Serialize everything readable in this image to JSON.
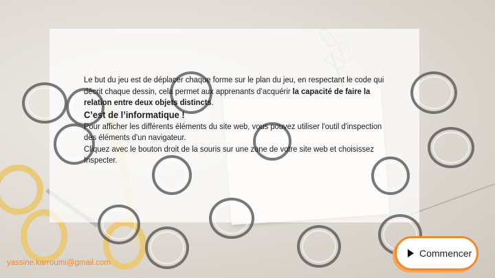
{
  "intro": {
    "text_before": "Le but du jeu est de déplacer chaque forme sur le plan du jeu, en respectant le code qui décrit chaque dessin, cela permet aux apprenants d’acquérir ",
    "text_bold": "la capacité de faire la relation entre deux objets distincts",
    "text_after": "."
  },
  "section": {
    "heading": "C’est de l’informatique !",
    "line1": "Pour afficher les différents éléments du site web, vous pouvez utiliser l'outil d'inspection des éléments d'un navigateur.",
    "line2": "Cliquez avec le bouton droit de la souris sur une zone de votre site web et choisissez Inspecter."
  },
  "start_button": {
    "label": "Commencer"
  },
  "footer": {
    "email": "yassine.karroumi@gmail.com"
  },
  "colors": {
    "accent": "#f08a2c",
    "ring": "#5a5a5a"
  }
}
